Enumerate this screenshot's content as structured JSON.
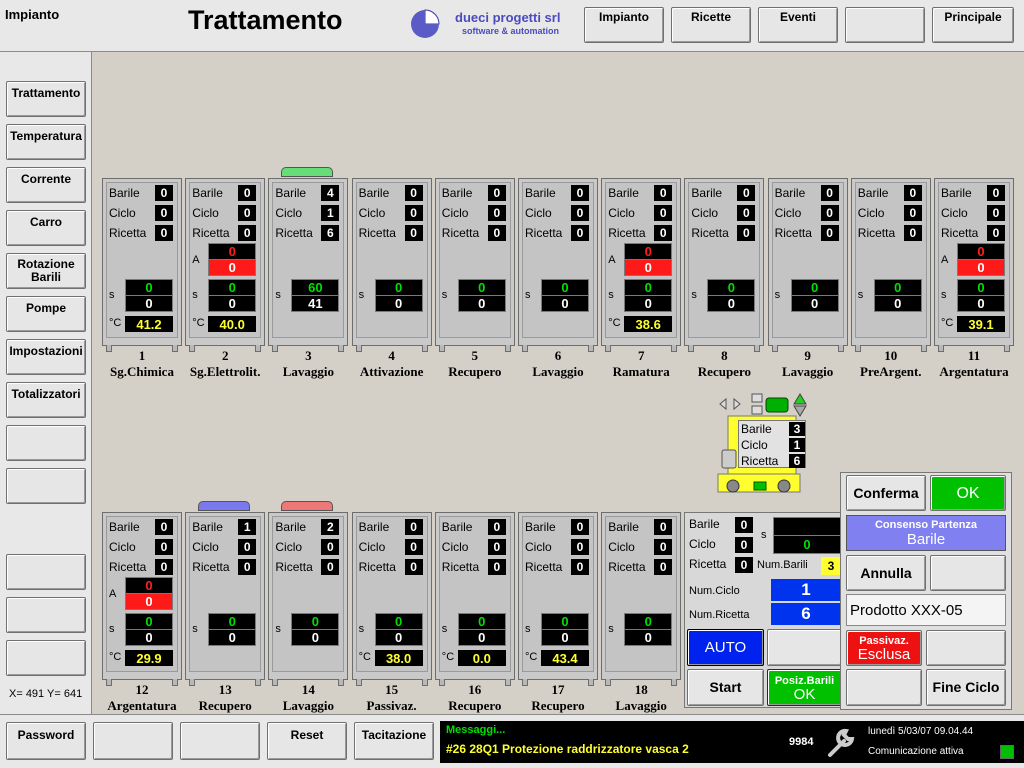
{
  "header": {
    "section": "Impianto",
    "title": "Trattamento",
    "logo_name": "dueci progetti srl",
    "logo_tagline": "software & automation",
    "nav": [
      "Impianto",
      "Ricette",
      "Eventi",
      "",
      "Principale"
    ]
  },
  "sidebar": {
    "items": [
      "Trattamento",
      "Temperatura",
      "Corrente",
      "Carro",
      "Rotazione Barili",
      "Pompe",
      "Impostazioni",
      "Totalizzatori",
      "",
      "",
      "",
      "",
      ""
    ],
    "coords": "X= 491 Y= 641"
  },
  "labels": {
    "barile": "Barile",
    "ciclo": "Ciclo",
    "ricetta": "Ricetta",
    "a": "A",
    "s": "s",
    "deg": "°C"
  },
  "tanks_top": [
    {
      "num": "1",
      "name": "Sg.Chimica",
      "barile": "0",
      "ciclo": "0",
      "ricetta": "0",
      "a": null,
      "s": [
        "0",
        "0"
      ],
      "temp": "41.2",
      "lid": null
    },
    {
      "num": "2",
      "name": "Sg.Elettrolit.",
      "barile": "0",
      "ciclo": "0",
      "ricetta": "0",
      "a": [
        "0",
        "0"
      ],
      "s": [
        "0",
        "0"
      ],
      "temp": "40.0",
      "lid": null
    },
    {
      "num": "3",
      "name": "Lavaggio",
      "barile": "4",
      "ciclo": "1",
      "ricetta": "6",
      "a": null,
      "s": [
        "60",
        "41"
      ],
      "temp": null,
      "lid": "#66dd77"
    },
    {
      "num": "4",
      "name": "Attivazione",
      "barile": "0",
      "ciclo": "0",
      "ricetta": "0",
      "a": null,
      "s": [
        "0",
        "0"
      ],
      "temp": null,
      "lid": null
    },
    {
      "num": "5",
      "name": "Recupero",
      "barile": "0",
      "ciclo": "0",
      "ricetta": "0",
      "a": null,
      "s": [
        "0",
        "0"
      ],
      "temp": null,
      "lid": null
    },
    {
      "num": "6",
      "name": "Lavaggio",
      "barile": "0",
      "ciclo": "0",
      "ricetta": "0",
      "a": null,
      "s": [
        "0",
        "0"
      ],
      "temp": null,
      "lid": null
    },
    {
      "num": "7",
      "name": "Ramatura",
      "barile": "0",
      "ciclo": "0",
      "ricetta": "0",
      "a": [
        "0",
        "0"
      ],
      "s": [
        "0",
        "0"
      ],
      "temp": "38.6",
      "lid": null
    },
    {
      "num": "8",
      "name": "Recupero",
      "barile": "0",
      "ciclo": "0",
      "ricetta": "0",
      "a": null,
      "s": [
        "0",
        "0"
      ],
      "temp": null,
      "lid": null
    },
    {
      "num": "9",
      "name": "Lavaggio",
      "barile": "0",
      "ciclo": "0",
      "ricetta": "0",
      "a": null,
      "s": [
        "0",
        "0"
      ],
      "temp": null,
      "lid": null
    },
    {
      "num": "10",
      "name": "PreArgent.",
      "barile": "0",
      "ciclo": "0",
      "ricetta": "0",
      "a": null,
      "s": [
        "0",
        "0"
      ],
      "temp": null,
      "lid": null
    },
    {
      "num": "11",
      "name": "Argentatura",
      "barile": "0",
      "ciclo": "0",
      "ricetta": "0",
      "a": [
        "0",
        "0"
      ],
      "s": [
        "0",
        "0"
      ],
      "temp": "39.1",
      "lid": null
    }
  ],
  "tanks_bottom": [
    {
      "num": "12",
      "name": "Argentatura",
      "barile": "0",
      "ciclo": "0",
      "ricetta": "0",
      "a": [
        "0",
        "0"
      ],
      "s": [
        "0",
        "0"
      ],
      "temp": "29.9",
      "lid": null
    },
    {
      "num": "13",
      "name": "Recupero",
      "barile": "1",
      "ciclo": "0",
      "ricetta": "0",
      "a": null,
      "s": [
        "0",
        "0"
      ],
      "temp": null,
      "lid": "#7a7aee"
    },
    {
      "num": "14",
      "name": "Lavaggio",
      "barile": "2",
      "ciclo": "0",
      "ricetta": "0",
      "a": null,
      "s": [
        "0",
        "0"
      ],
      "temp": null,
      "lid": "#ee7777"
    },
    {
      "num": "15",
      "name": "Passivaz.",
      "barile": "0",
      "ciclo": "0",
      "ricetta": "0",
      "a": null,
      "s": [
        "0",
        "0"
      ],
      "temp": "38.0",
      "lid": null
    },
    {
      "num": "16",
      "name": "Recupero",
      "barile": "0",
      "ciclo": "0",
      "ricetta": "0",
      "a": null,
      "s": [
        "0",
        "0"
      ],
      "temp": "0.0",
      "lid": null
    },
    {
      "num": "17",
      "name": "Recupero",
      "barile": "0",
      "ciclo": "0",
      "ricetta": "0",
      "a": null,
      "s": [
        "0",
        "0"
      ],
      "temp": "43.4",
      "lid": null
    },
    {
      "num": "18",
      "name": "Lavaggio",
      "barile": "0",
      "ciclo": "0",
      "ricetta": "0",
      "a": null,
      "s": [
        "0",
        "0"
      ],
      "temp": null,
      "lid": null
    }
  ],
  "carriage": {
    "barile": "3",
    "ciclo": "1",
    "ricetta": "6"
  },
  "loading_station": {
    "barile": "0",
    "ciclo": "0",
    "ricetta": "0",
    "s_top": "",
    "s_bot": "0",
    "num_barili_label": "Num.Barili",
    "num_barili": "3",
    "num_ciclo_label": "Num.Ciclo",
    "num_ciclo": "1",
    "num_ricetta_label": "Num.Ricetta",
    "num_ricetta": "6",
    "auto": "AUTO",
    "start": "Start",
    "posiz_label": "Posiz.Barili",
    "posiz_value": "OK"
  },
  "control": {
    "conferma": "Conferma",
    "ok": "OK",
    "consenso_label": "Consenso Partenza",
    "consenso_value": "Barile",
    "annulla": "Annulla",
    "prodotto": "Prodotto XXX-05",
    "passivaz_label": "Passivaz.",
    "passivaz_value": "Esclusa",
    "fine_ciclo": "Fine Ciclo"
  },
  "footer": {
    "buttons": [
      "Password",
      "",
      "",
      "Reset",
      "Tacitazione"
    ],
    "msg_title": "Messaggi...",
    "msg_text": "#26 28Q1 Protezione raddrizzatore vasca 2",
    "msg_code": "9984",
    "datetime": "lunedì 5/03/07 09.04.44",
    "comm": "Comunicazione attiva"
  },
  "colors": {
    "green": "#00c000",
    "blue": "#0033ee",
    "red": "#ee1111",
    "lavender": "#8080f0",
    "yellow": "#ffff30"
  }
}
